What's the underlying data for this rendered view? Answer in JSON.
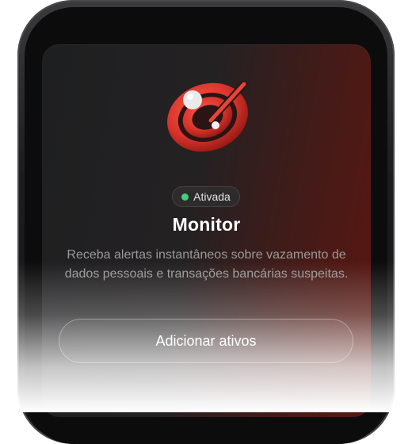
{
  "badge": {
    "label": "Ativada",
    "status_color": "#3ed27a"
  },
  "card": {
    "title": "Monitor",
    "description": "Receba alertas instantâneos sobre vazamento de dados pessoais e transações bancárias suspeitas."
  },
  "actions": {
    "add_assets_label": "Adicionar ativos"
  },
  "colors": {
    "accent": "#d8342b",
    "card_gradient_end": "#5a1610"
  },
  "icons": {
    "feature_logo": "monitor-radar-icon"
  }
}
